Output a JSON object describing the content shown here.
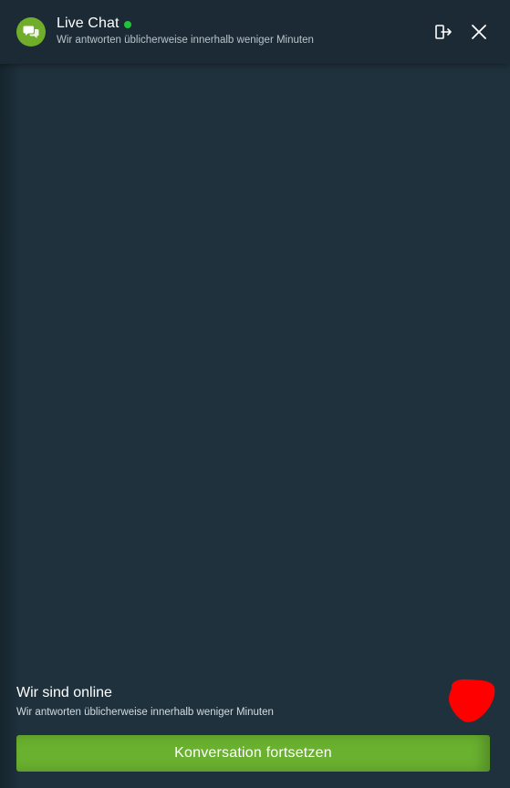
{
  "header": {
    "title": "Live Chat",
    "subtitle": "Wir antworten üblicherweise innerhalb weniger Minuten",
    "status": "online",
    "icons": {
      "avatar": "chat-bubbles-icon",
      "logout": "logout-icon",
      "close": "close-icon"
    }
  },
  "footer": {
    "title": "Wir sind online",
    "subtitle": "Wir antworten üblicherweise innerhalb weniger Minuten",
    "cta_label": "Konversation fortsetzen"
  },
  "colors": {
    "background": "#1f313c",
    "header_bg": "#1b2a34",
    "accent": "#6ab12f",
    "online_dot": "#1fc43a",
    "red_mark": "#ff0000"
  }
}
